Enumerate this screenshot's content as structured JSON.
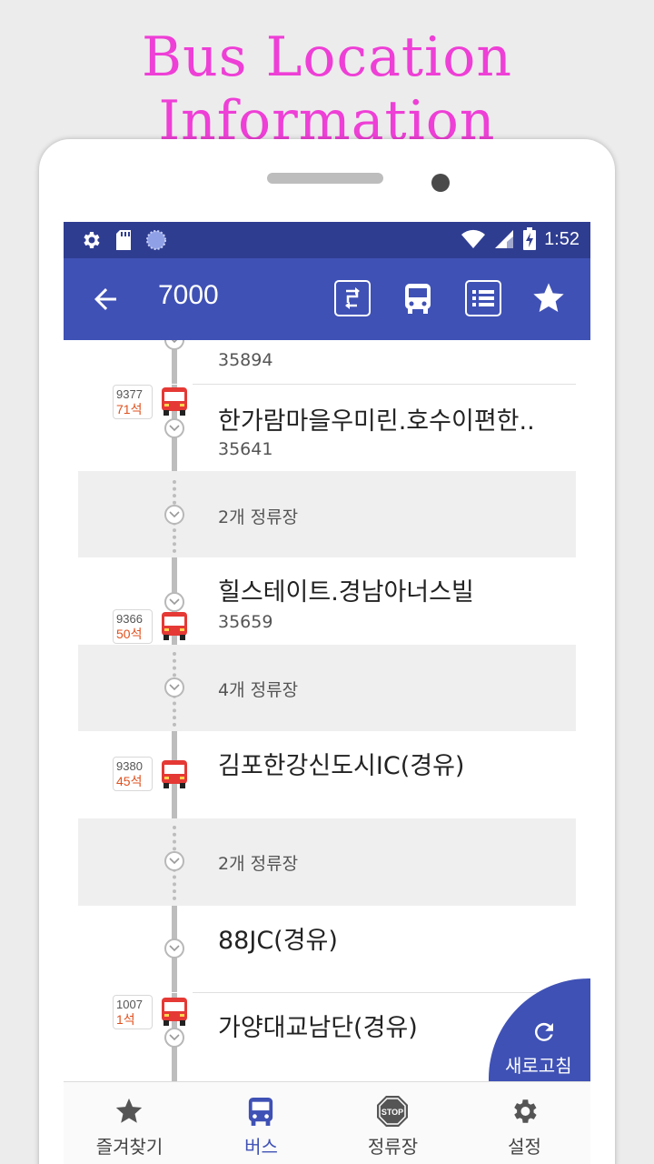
{
  "promo": {
    "title": "Bus Location Information"
  },
  "status_bar": {
    "time": "1:52"
  },
  "app_bar": {
    "route_number": "7000"
  },
  "stops": [
    {
      "name": "",
      "id": "35894"
    },
    {
      "name": "한가람마을우미린.호수이편한..",
      "id": "35641"
    },
    {
      "gap_label": "2개 정류장"
    },
    {
      "name": "힐스테이트.경남아너스빌",
      "id": "35659"
    },
    {
      "gap_label": "4개 정류장"
    },
    {
      "name": "김포한강신도시IC(경유)",
      "id": ""
    },
    {
      "gap_label": "2개 정류장"
    },
    {
      "name": "88JC(경유)",
      "id": ""
    },
    {
      "name": "가양대교남단(경유)",
      "id": ""
    }
  ],
  "buses": [
    {
      "plate": "9377",
      "seats": "71석"
    },
    {
      "plate": "9366",
      "seats": "50석"
    },
    {
      "plate": "9380",
      "seats": "45석"
    },
    {
      "plate": "1007",
      "seats": "1석"
    }
  ],
  "refresh": {
    "label": "새로고침"
  },
  "bottom_nav": [
    {
      "label": "즐겨찾기",
      "icon": "star-icon"
    },
    {
      "label": "버스",
      "icon": "bus-icon"
    },
    {
      "label": "정류장",
      "icon": "stop-sign-icon",
      "stop_text": "STOP"
    },
    {
      "label": "설정",
      "icon": "gear-icon"
    }
  ],
  "colors": {
    "primary": "#3f51b5",
    "primary_dark": "#2f3d91",
    "promo": "#ee3fd6",
    "bus_red": "#e53935",
    "seats": "#e0501e"
  }
}
